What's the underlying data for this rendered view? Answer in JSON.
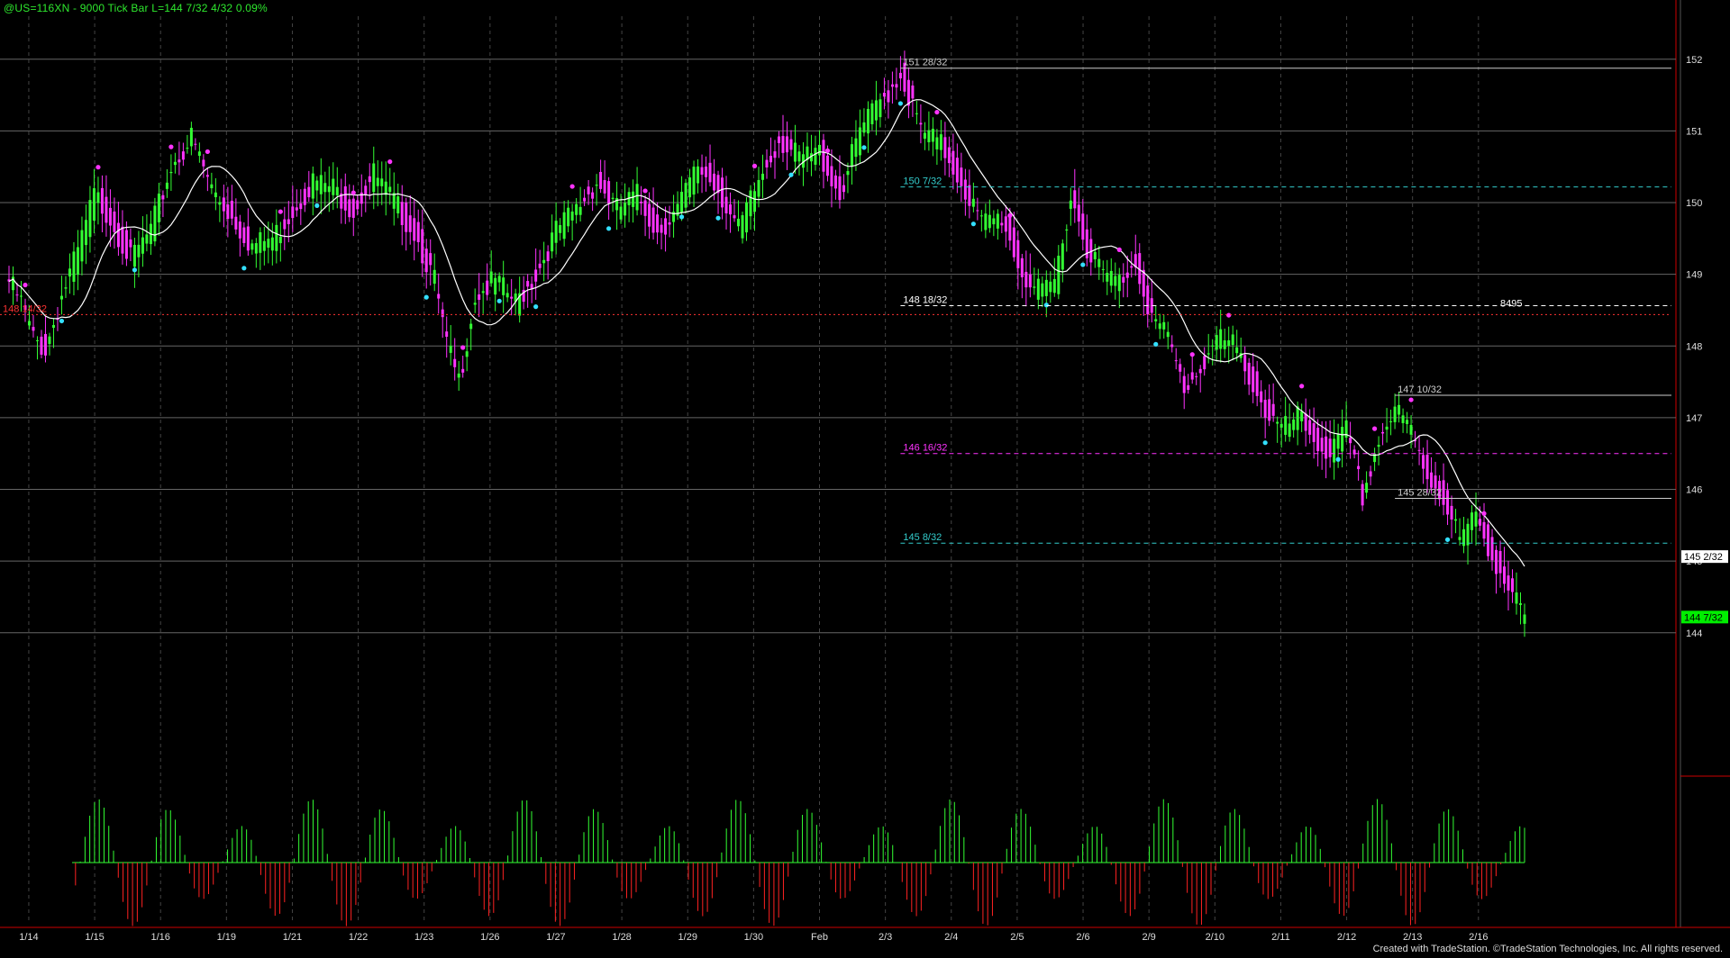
{
  "header": {
    "text": "@US=116XN - 9000 Tick Bar  L=144 7/32  4/32  0.09%"
  },
  "footer": {
    "text": "Created with TradeStation. ©TradeStation Technologies, Inc. All rights reserved."
  },
  "colors": {
    "background": "#000000",
    "up_bar": "#33ff33",
    "down_bar": "#ff33ff",
    "ma_line": "#ffffff",
    "swing_high": "#ff33ff",
    "swing_low": "#33e0ff",
    "grid": "#666666",
    "osc_up": "#33ff33",
    "osc_down": "#ff2222",
    "last_price_bg": "#00ee00",
    "frame_red": "#cc0000"
  },
  "chart_data": [
    {
      "type": "candlestick",
      "title": "",
      "x_tick_labels": [
        "1/14",
        "1/15",
        "1/16",
        "1/19",
        "1/21",
        "1/22",
        "1/23",
        "1/26",
        "1/27",
        "1/28",
        "1/29",
        "1/30",
        "Feb",
        "2/3",
        "2/4",
        "2/5",
        "2/6",
        "2/9",
        "2/10",
        "2/11",
        "2/12",
        "2/13",
        "2/16"
      ],
      "y_tick_labels": [
        "144",
        "145",
        "146",
        "147",
        "148",
        "149",
        "150",
        "151",
        "152"
      ],
      "ylim": [
        142.0,
        152.6
      ],
      "grid": true,
      "right_axis_readouts": [
        {
          "label": "145 2/32",
          "value": 145.0625,
          "style": "white"
        },
        {
          "label": "144 7/32",
          "value": 144.21875,
          "style": "green"
        }
      ],
      "price_close_path": [
        {
          "i": 0,
          "y": 148.9
        },
        {
          "i": 3,
          "y": 148.6
        },
        {
          "i": 6,
          "y": 148.1
        },
        {
          "i": 9,
          "y": 147.95
        },
        {
          "i": 13,
          "y": 148.7
        },
        {
          "i": 17,
          "y": 149.3
        },
        {
          "i": 21,
          "y": 150.1
        },
        {
          "i": 25,
          "y": 149.8
        },
        {
          "i": 30,
          "y": 149.2
        },
        {
          "i": 35,
          "y": 149.6
        },
        {
          "i": 40,
          "y": 150.5
        },
        {
          "i": 45,
          "y": 150.9
        },
        {
          "i": 50,
          "y": 150.2
        },
        {
          "i": 55,
          "y": 149.8
        },
        {
          "i": 60,
          "y": 149.4
        },
        {
          "i": 65,
          "y": 149.5
        },
        {
          "i": 70,
          "y": 149.9
        },
        {
          "i": 75,
          "y": 150.3
        },
        {
          "i": 80,
          "y": 150.2
        },
        {
          "i": 85,
          "y": 149.9
        },
        {
          "i": 90,
          "y": 150.4
        },
        {
          "i": 95,
          "y": 150.0
        },
        {
          "i": 100,
          "y": 149.6
        },
        {
          "i": 105,
          "y": 148.9
        },
        {
          "i": 108,
          "y": 148.0
        },
        {
          "i": 111,
          "y": 147.5
        },
        {
          "i": 115,
          "y": 148.7
        },
        {
          "i": 120,
          "y": 148.9
        },
        {
          "i": 125,
          "y": 148.6
        },
        {
          "i": 130,
          "y": 149.0
        },
        {
          "i": 135,
          "y": 149.6
        },
        {
          "i": 140,
          "y": 149.9
        },
        {
          "i": 145,
          "y": 150.3
        },
        {
          "i": 150,
          "y": 149.9
        },
        {
          "i": 155,
          "y": 150.1
        },
        {
          "i": 160,
          "y": 149.6
        },
        {
          "i": 165,
          "y": 149.9
        },
        {
          "i": 170,
          "y": 150.5
        },
        {
          "i": 175,
          "y": 150.2
        },
        {
          "i": 180,
          "y": 149.6
        },
        {
          "i": 185,
          "y": 150.3
        },
        {
          "i": 190,
          "y": 150.9
        },
        {
          "i": 195,
          "y": 150.6
        },
        {
          "i": 200,
          "y": 150.7
        },
        {
          "i": 205,
          "y": 150.1
        },
        {
          "i": 210,
          "y": 151.0
        },
        {
          "i": 215,
          "y": 151.4
        },
        {
          "i": 220,
          "y": 151.8
        },
        {
          "i": 225,
          "y": 151.0
        },
        {
          "i": 230,
          "y": 150.8
        },
        {
          "i": 235,
          "y": 150.3
        },
        {
          "i": 240,
          "y": 149.7
        },
        {
          "i": 245,
          "y": 149.8
        },
        {
          "i": 250,
          "y": 149.0
        },
        {
          "i": 255,
          "y": 148.7
        },
        {
          "i": 258,
          "y": 148.9
        },
        {
          "i": 262,
          "y": 150.1
        },
        {
          "i": 266,
          "y": 149.4
        },
        {
          "i": 270,
          "y": 149.0
        },
        {
          "i": 274,
          "y": 148.9
        },
        {
          "i": 278,
          "y": 149.2
        },
        {
          "i": 282,
          "y": 148.4
        },
        {
          "i": 286,
          "y": 148.1
        },
        {
          "i": 290,
          "y": 147.4
        },
        {
          "i": 294,
          "y": 147.7
        },
        {
          "i": 298,
          "y": 148.1
        },
        {
          "i": 302,
          "y": 148.0
        },
        {
          "i": 306,
          "y": 147.6
        },
        {
          "i": 310,
          "y": 147.1
        },
        {
          "i": 314,
          "y": 146.8
        },
        {
          "i": 318,
          "y": 147.0
        },
        {
          "i": 322,
          "y": 146.7
        },
        {
          "i": 326,
          "y": 146.5
        },
        {
          "i": 330,
          "y": 146.8
        },
        {
          "i": 334,
          "y": 145.9
        },
        {
          "i": 338,
          "y": 146.7
        },
        {
          "i": 342,
          "y": 147.1
        },
        {
          "i": 346,
          "y": 146.8
        },
        {
          "i": 350,
          "y": 146.2
        },
        {
          "i": 354,
          "y": 145.9
        },
        {
          "i": 358,
          "y": 145.3
        },
        {
          "i": 362,
          "y": 145.6
        },
        {
          "i": 366,
          "y": 145.1
        },
        {
          "i": 370,
          "y": 144.6
        },
        {
          "i": 374,
          "y": 144.2
        }
      ],
      "bar_count": 375,
      "horizontal_levels": [
        {
          "label": "151 28/32",
          "value": 151.875,
          "color": "#cccccc",
          "style": "solid",
          "start_i": 220
        },
        {
          "label": "150 7/32",
          "value": 150.21875,
          "color": "#33cccc",
          "style": "dashed",
          "start_i": 220
        },
        {
          "label": "148 18/32",
          "value": 148.5625,
          "color": "#ffffff",
          "style": "dashed",
          "start_i": 220
        },
        {
          "label": "148 14/32",
          "value": 148.4375,
          "color": "#ff3333",
          "style": "dotted",
          "start_i": 0
        },
        {
          "label": "147 10/32",
          "value": 147.3125,
          "color": "#cccccc",
          "style": "solid",
          "start_i": 342
        },
        {
          "label": "146 16/32",
          "value": 146.5,
          "color": "#ff33ff",
          "style": "dashed",
          "start_i": 220
        },
        {
          "label": "145 28/32",
          "value": 145.875,
          "color": "#cccccc",
          "style": "solid",
          "start_i": 342
        },
        {
          "label": "145 8/32",
          "value": 145.25,
          "color": "#33cccc",
          "style": "dashed",
          "start_i": 220
        }
      ],
      "annotations": [
        {
          "text": "8495",
          "value": 148.6,
          "i": 368
        }
      ],
      "ylabel": "",
      "xlabel": ""
    },
    {
      "type": "histogram",
      "title": "",
      "series": [
        {
          "name": "",
          "x": [
            0,
            30,
            60,
            90,
            120,
            150,
            180,
            210,
            240,
            270,
            300,
            330,
            360,
            372
          ],
          "values": [
            0,
            1,
            0.6,
            1,
            0.5,
            1,
            0.7,
            1,
            0.4,
            1,
            0.6,
            0.8,
            0.3,
            0
          ]
        }
      ],
      "ylim": [
        -1,
        1
      ]
    }
  ]
}
